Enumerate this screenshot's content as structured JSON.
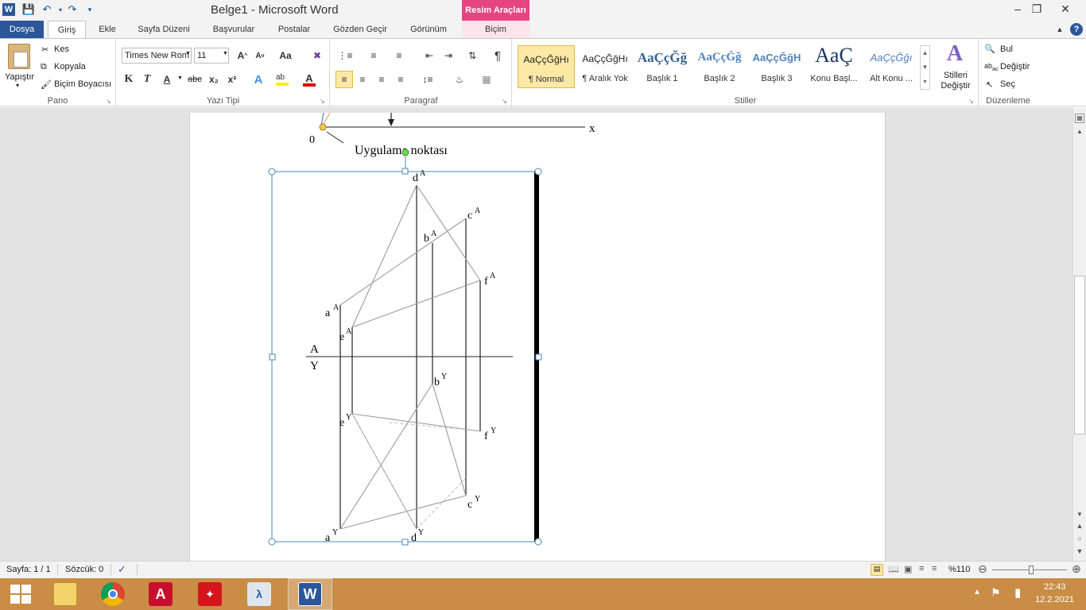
{
  "window": {
    "title": "Belge1 - Microsoft Word",
    "context_tab_header": "Resim Araçları"
  },
  "tabs": [
    "Dosya",
    "Giriş",
    "Ekle",
    "Sayfa Düzeni",
    "Başvurular",
    "Postalar",
    "Gözden Geçir",
    "Görünüm",
    "Biçim"
  ],
  "ribbon": {
    "clipboard": {
      "paste": "Yapıştır",
      "cut": "Kes",
      "copy": "Kopyala",
      "format_painter": "Biçim Boyacısı",
      "label": "Pano"
    },
    "font": {
      "name": "Times New Rom",
      "size": "11",
      "label": "Yazı Tipi",
      "bold": "K",
      "italic": "T",
      "underline": "A",
      "strike": "abc",
      "subscript": "x₂",
      "superscript": "x²",
      "change_case": "Aa"
    },
    "paragraph": {
      "label": "Paragraf",
      "pilcrow": "¶"
    },
    "styles": {
      "label": "Stiller",
      "items": [
        {
          "sample": "AaÇçĞğHı",
          "name": "¶ Normal"
        },
        {
          "sample": "AaÇçĞğHı",
          "name": "¶ Aralık Yok"
        },
        {
          "sample": "AaÇçĞğ",
          "name": "Başlık 1"
        },
        {
          "sample": "AaÇçĞğ",
          "name": "Başlık 2"
        },
        {
          "sample": "AaÇçĞğH",
          "name": "Başlık 3"
        },
        {
          "sample": "AaÇ",
          "name": "Konu Başl..."
        },
        {
          "sample": "AaÇçĞğı",
          "name": "Alt Konu ..."
        }
      ],
      "change_styles": "Stilleri Değiştir"
    },
    "editing": {
      "find": "Bul",
      "replace": "Değiştir",
      "select": "Seç",
      "label": "Düzenleme"
    }
  },
  "document": {
    "axis_x_label": "x",
    "origin_label": "0",
    "note_text": "Uygulama noktası",
    "plane_top": "A",
    "plane_bottom": "Y",
    "points_a": {
      "a": "a",
      "b": "b",
      "c": "c",
      "d": "d",
      "e": "e",
      "f": "f",
      "sup": "A"
    },
    "points_y": {
      "a": "a",
      "b": "b",
      "c": "c",
      "d": "d",
      "e": "e",
      "f": "f",
      "sup": "Y"
    }
  },
  "statusbar": {
    "page": "Sayfa: 1 / 1",
    "words": "Sözcük: 0",
    "zoom": "%110"
  },
  "taskbar": {
    "time": "22:43",
    "date": "12.2.2021"
  },
  "colors": {
    "word_blue": "#2b579a",
    "context_pink": "#e7457f",
    "taskbar": "#c98d45"
  }
}
